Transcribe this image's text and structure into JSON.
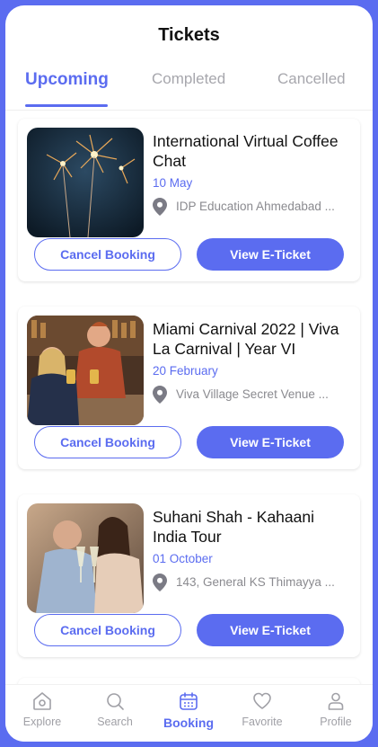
{
  "header": {
    "title": "Tickets"
  },
  "tabs": [
    {
      "label": "Upcoming",
      "active": true
    },
    {
      "label": "Completed",
      "active": false
    },
    {
      "label": "Cancelled",
      "active": false
    }
  ],
  "tickets": [
    {
      "title": "International Virtual Coffee Chat",
      "date": "10 May",
      "venue": "IDP Education Ahmedabad ...",
      "cancel_label": "Cancel Booking",
      "view_label": "View E-Ticket"
    },
    {
      "title": "Miami Carnival 2022 | Viva La Carnival | Year VI",
      "date": "20 February",
      "venue": "Viva Village Secret Venue ...",
      "cancel_label": "Cancel Booking",
      "view_label": "View E-Ticket"
    },
    {
      "title": "Suhani Shah - Kahaani India Tour",
      "date": "01 October",
      "venue": "143, General KS Thimayya ...",
      "cancel_label": "Cancel Booking",
      "view_label": "View E-Ticket"
    }
  ],
  "bottom_nav": [
    {
      "label": "Explore",
      "icon": "explore-icon",
      "active": false
    },
    {
      "label": "Search",
      "icon": "search-icon",
      "active": false
    },
    {
      "label": "Booking",
      "icon": "calendar-icon",
      "active": true
    },
    {
      "label": "Favorite",
      "icon": "heart-icon",
      "active": false
    },
    {
      "label": "Profile",
      "icon": "profile-icon",
      "active": false
    }
  ],
  "colors": {
    "accent": "#5b6cf0",
    "muted": "#a7a7ad",
    "text": "#111111"
  }
}
